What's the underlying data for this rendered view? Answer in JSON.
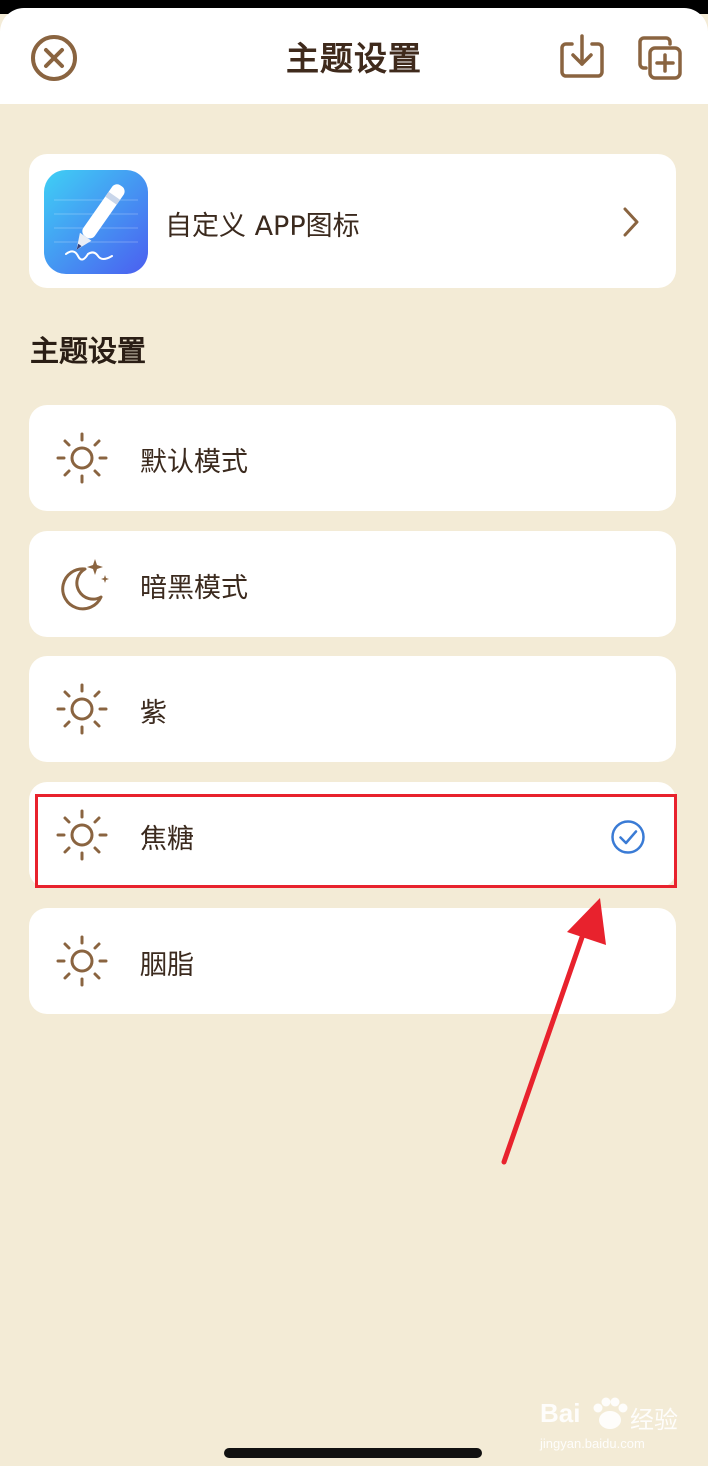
{
  "header": {
    "title": "主题设置",
    "close_icon": "close-circle-icon",
    "import_icon": "download-tray-icon",
    "add_icon": "add-copy-icon"
  },
  "app_icon_card": {
    "label": "自定义 APP图标",
    "icon": "pen-app-icon",
    "chevron_icon": "chevron-right-icon"
  },
  "section": {
    "heading": "主题设置"
  },
  "themes": [
    {
      "label": "默认模式",
      "icon": "sun-icon",
      "selected": false
    },
    {
      "label": "暗黑模式",
      "icon": "moon-stars-icon",
      "selected": false
    },
    {
      "label": "紫",
      "icon": "sun-icon",
      "selected": false
    },
    {
      "label": "焦糖",
      "icon": "sun-icon",
      "selected": true
    },
    {
      "label": "胭脂",
      "icon": "sun-icon",
      "selected": false
    }
  ],
  "watermark": {
    "line1": "Bai",
    "line2": "经验",
    "line3": "jingyan.baidu.com"
  },
  "colors": {
    "background": "#f3ebd6",
    "accent_brown": "#8a6440",
    "check_blue": "#3a7bd5",
    "annotation_red": "#e8222d"
  }
}
